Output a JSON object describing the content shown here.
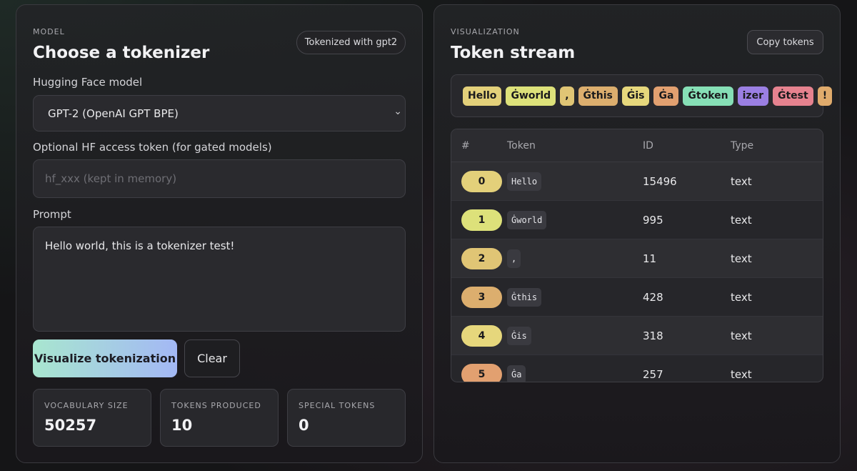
{
  "model_panel": {
    "eyebrow": "MODEL",
    "title": "Choose a tokenizer",
    "badge": "Tokenized with gpt2",
    "hf_model_label": "Hugging Face model",
    "hf_model_value": "GPT-2 (OpenAI GPT BPE)",
    "token_label": "Optional HF access token (for gated models)",
    "token_placeholder": "hf_xxx (kept in memory)",
    "prompt_label": "Prompt",
    "prompt_value": "Hello world, this is a tokenizer test!",
    "visualize_label": "Visualize tokenization",
    "clear_label": "Clear",
    "stats": [
      {
        "label": "VOCABULARY SIZE",
        "value": "50257"
      },
      {
        "label": "TOKENS PRODUCED",
        "value": "10"
      },
      {
        "label": "SPECIAL TOKENS",
        "value": "0"
      }
    ]
  },
  "viz_panel": {
    "eyebrow": "VISUALIZATION",
    "title": "Token stream",
    "copy_label": "Copy tokens",
    "chips": [
      {
        "text": "Hello",
        "color": "#e3d07a"
      },
      {
        "text": "Ġworld",
        "color": "#dde17a"
      },
      {
        "text": ",",
        "color": "#e0c575"
      },
      {
        "text": "Ġthis",
        "color": "#dcae6e"
      },
      {
        "text": "Ġis",
        "color": "#e6d77c"
      },
      {
        "text": "Ġa",
        "color": "#e2a070"
      },
      {
        "text": "Ġtoken",
        "color": "#86dfb6"
      },
      {
        "text": "izer",
        "color": "#9b7fe3"
      },
      {
        "text": "Ġtest",
        "color": "#e6828f"
      },
      {
        "text": "!",
        "color": "#e0ab6c"
      }
    ],
    "table": {
      "headers": [
        "#",
        "Token",
        "ID",
        "Type"
      ],
      "rows": [
        {
          "index": "0",
          "token": "Hello",
          "id": "15496",
          "type": "text",
          "color": "#e3d07a"
        },
        {
          "index": "1",
          "token": "Ġworld",
          "id": "995",
          "type": "text",
          "color": "#dde17a"
        },
        {
          "index": "2",
          "token": ",",
          "id": "11",
          "type": "text",
          "color": "#e0c575"
        },
        {
          "index": "3",
          "token": "Ġthis",
          "id": "428",
          "type": "text",
          "color": "#dcae6e"
        },
        {
          "index": "4",
          "token": "Ġis",
          "id": "318",
          "type": "text",
          "color": "#e6d77c"
        },
        {
          "index": "5",
          "token": "Ġa",
          "id": "257",
          "type": "text",
          "color": "#e2a070"
        }
      ]
    }
  }
}
